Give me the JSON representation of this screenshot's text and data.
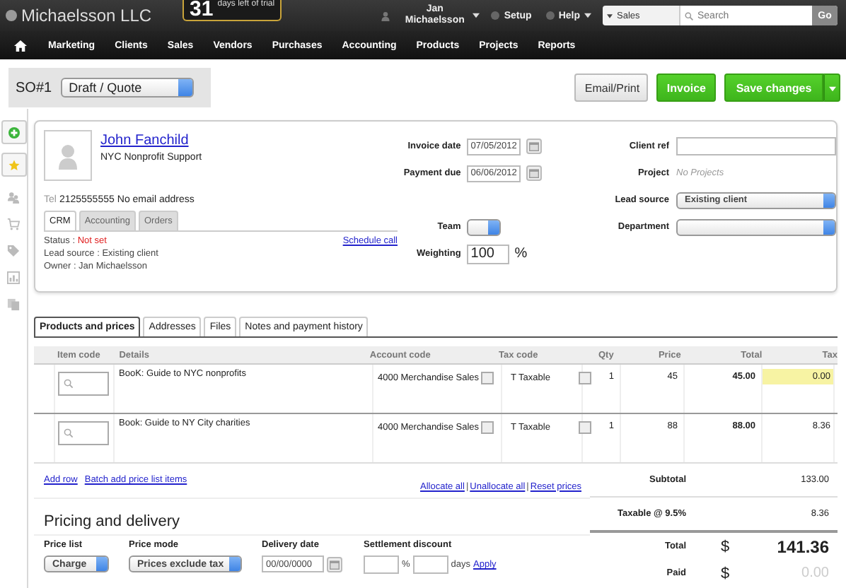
{
  "header": {
    "company": "Michaelsson LLC",
    "trial_days": "31",
    "trial_text": "days left of trial",
    "user": "Jan Michaelsson",
    "setup": "Setup",
    "help": "Help",
    "search_scope": "Sales",
    "search_placeholder": "Search",
    "go": "Go"
  },
  "nav": [
    "Marketing",
    "Clients",
    "Sales",
    "Vendors",
    "Purchases",
    "Accounting",
    "Products",
    "Projects",
    "Reports"
  ],
  "toolbar": {
    "doc_number": "SO#1",
    "status": "Draft / Quote",
    "buttons": [
      {
        "label": "Email/Print",
        "kind": "plain"
      },
      {
        "label": "Invoice",
        "kind": "primary"
      },
      {
        "label": "Save changes",
        "kind": "split"
      }
    ]
  },
  "contact": {
    "name": "John Fanchild",
    "org": "NYC Nonprofit Support",
    "tel_label": "Tel",
    "tel": "2125555555",
    "email": "No email address",
    "tabs": [
      {
        "label": "CRM",
        "selected": true
      },
      {
        "label": "Accounting",
        "selected": false
      },
      {
        "label": "Orders",
        "selected": false
      }
    ],
    "status_label": "Status :",
    "status": "Not set",
    "lead_source": "Lead source : Existing client",
    "owner": "Owner : Jan Michaelsson",
    "schedule": "Schedule call"
  },
  "form_left": [
    {
      "label": "Invoice date",
      "kind": "date",
      "value": "07/05/2012"
    },
    {
      "label": "Payment due",
      "kind": "date",
      "value": "06/06/2012"
    },
    {
      "label": "Team",
      "kind": "select"
    },
    {
      "label": "Weighting",
      "kind": "percent",
      "value": "100",
      "unit": "%"
    }
  ],
  "form_right": [
    {
      "label": "Client ref",
      "kind": "text"
    },
    {
      "label": "Project",
      "kind": "static",
      "value": "No Projects"
    },
    {
      "label": "Lead source",
      "kind": "select",
      "value": "Existing client"
    },
    {
      "label": "Department",
      "kind": "select"
    }
  ],
  "detail_tabs": [
    {
      "label": "Products and prices",
      "selected": true
    },
    {
      "label": "Addresses",
      "selected": false
    },
    {
      "label": "Files",
      "selected": false
    },
    {
      "label": "Notes and payment history",
      "selected": false
    }
  ],
  "table": {
    "columns": [
      "Item code",
      "Details",
      "Account code",
      "Tax code",
      "Qty",
      "Price",
      "Total",
      "Tax"
    ],
    "rows": [
      {
        "details": "BooK: Guide to NYC nonprofits",
        "account": "4000 Merchandise Sales",
        "tax_code": "T Taxable",
        "qty": "1",
        "price": "45",
        "total": "45.00",
        "tax": "0.00",
        "highlighted": true
      },
      {
        "details": "Book: Guide to NY City charities",
        "account": "4000 Merchandise Sales",
        "tax_code": "T Taxable",
        "qty": "1",
        "price": "88",
        "total": "88.00",
        "tax": "8.36",
        "highlighted": false
      }
    ]
  },
  "row_links": [
    "Add row",
    "Batch add price list items"
  ],
  "alloc_links": [
    "Allocate all",
    "Unallocate all",
    "Reset prices"
  ],
  "alloc_separators": [
    "|",
    "|"
  ],
  "pricing": {
    "title": "Pricing and delivery",
    "fields": [
      {
        "label": "Price list",
        "kind": "select",
        "value": "Charge"
      },
      {
        "label": "Price mode",
        "kind": "select",
        "value": "Prices exclude tax"
      },
      {
        "label": "Delivery date",
        "kind": "date",
        "value": "00/00/0000"
      },
      {
        "label": "Settlement discount",
        "kind": "discount",
        "percent": "%",
        "days": "days",
        "apply": "Apply"
      }
    ]
  },
  "totals": [
    {
      "label": "Subtotal",
      "kind": "plain",
      "value": "133.00"
    },
    {
      "label": "Taxable @ 9.5%",
      "kind": "plain",
      "value": "8.36"
    },
    {
      "label": "Total",
      "kind": "grand",
      "currency": "$",
      "value": "141.36"
    },
    {
      "label": "Paid",
      "kind": "paid",
      "currency": "$",
      "value": "0.00"
    }
  ]
}
